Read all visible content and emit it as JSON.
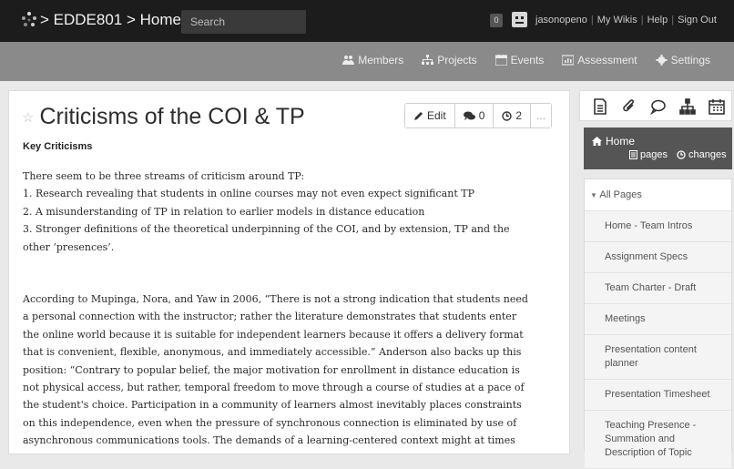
{
  "topbar": {
    "crumbs": "> EDDE801 > Home",
    "search_placeholder": "Search",
    "notif_count": "0",
    "user": "jasonopeno",
    "links": [
      "My Wikis",
      "Help",
      "Sign Out"
    ]
  },
  "subnav": {
    "items": [
      "Members",
      "Projects",
      "Events",
      "Assessment",
      "Settings"
    ]
  },
  "page": {
    "title": "Criticisms of the COI & TP",
    "actions": {
      "edit": "Edit",
      "comments": "0",
      "followers": "2",
      "more": "..."
    },
    "section_heading": "Key Criticisms",
    "paragraphs": [
      "There seem to be three streams of criticism around TP:",
      "1. Research revealing that students in online courses may not even expect significant TP",
      "2. A misunderstanding of TP in relation to earlier models in distance education",
      "3. Stronger definitions of the theoretical underpinning of the COI, and by extension, TP and the other ‘presences’.",
      "According to Mupinga, Nora, and Yaw in 2006, “There is not a strong indication that students need a personal connection with the instructor; rather the literature demonstrates that students enter the online world because it is suitable for independent learners because it offers a delivery format that is convenient, flexible, anonymous, and immediately accessible.” Anderson also backs up this position: “Contrary to popular belief, the major motivation for enrollment in distance education is not physical access, but rather, temporal freedom to move through a course of studies at a pace of the student's choice. Participation in a community of learners almost inevitably places constraints on this independence, even when the pressure of synchronous connection is eliminated by use of asynchronous communications tools. The demands of a learning-centered context might at times"
    ]
  },
  "sidebar": {
    "home_label": "Home",
    "home_pages": "pages",
    "home_changes": "changes",
    "all_pages": "All Pages",
    "pages": [
      "Home - Team Intros",
      "Assignment Specs",
      "Team Charter - Draft",
      "Meetings",
      "Presentation content planner",
      "Presentation Timesheet",
      "Teaching Presence - Summation and Description of Topic"
    ]
  }
}
